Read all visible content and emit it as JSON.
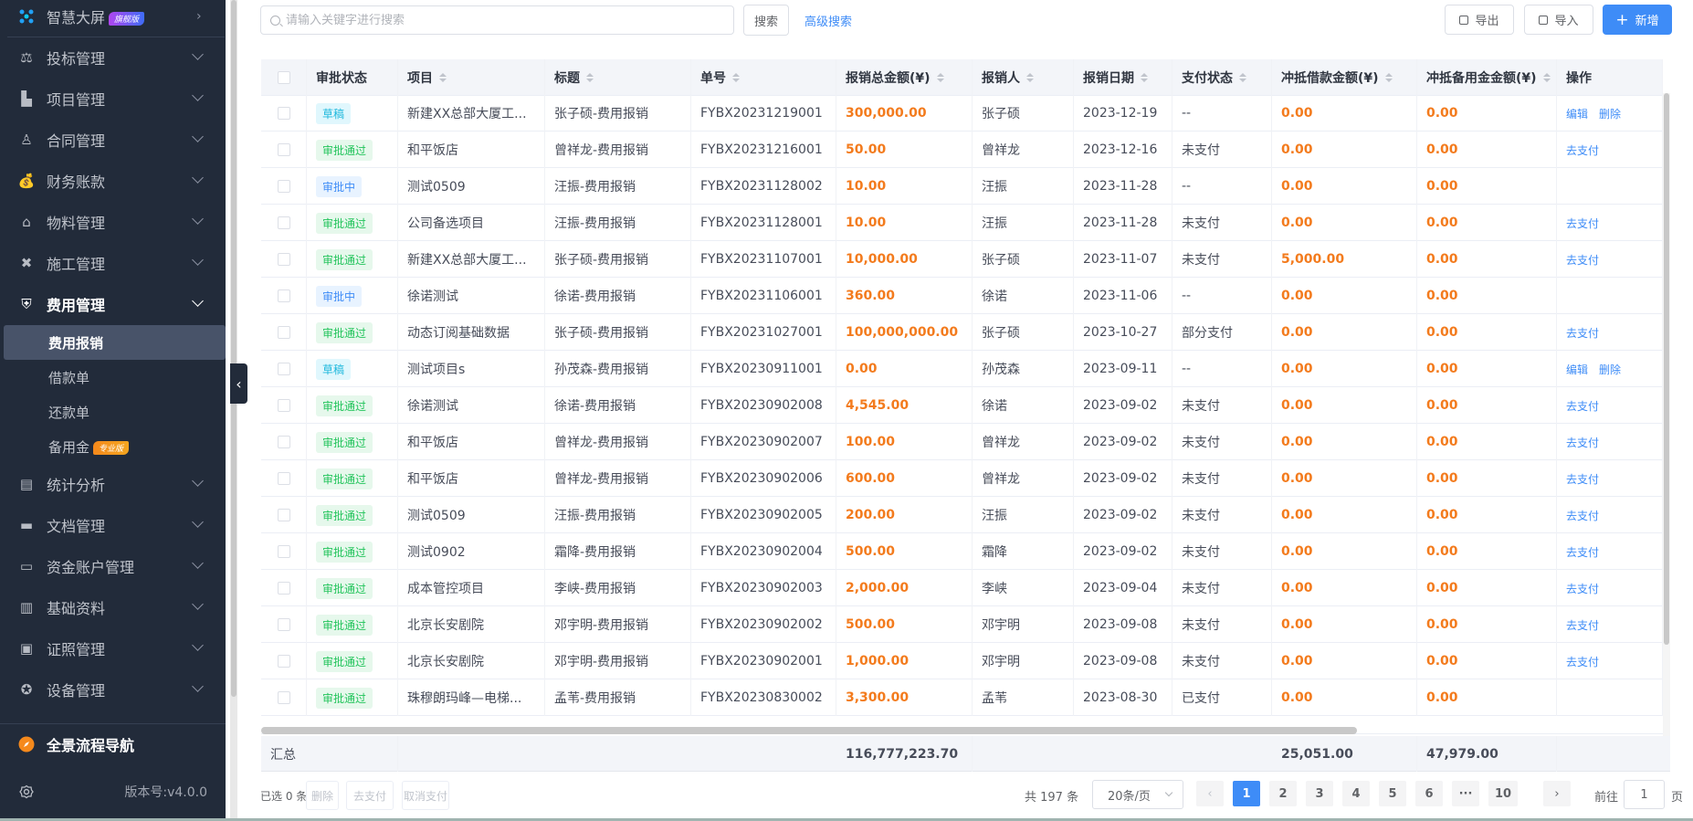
{
  "sidebar": {
    "top_item": {
      "label": "智慧大屏",
      "badge": "旗舰版",
      "icon": "dashboard-icon"
    },
    "items": [
      {
        "label": "投标管理",
        "icon": "gavel-icon"
      },
      {
        "label": "项目管理",
        "icon": "building-icon"
      },
      {
        "label": "合同管理",
        "icon": "stamp-icon"
      },
      {
        "label": "财务账款",
        "icon": "money-bag-icon"
      },
      {
        "label": "物料管理",
        "icon": "warehouse-icon"
      },
      {
        "label": "施工管理",
        "icon": "tools-icon"
      },
      {
        "label": "费用管理",
        "icon": "shield-yen-icon",
        "open": true
      }
    ],
    "sub_items": [
      {
        "label": "费用报销",
        "active": true
      },
      {
        "label": "借款单"
      },
      {
        "label": "还款单"
      },
      {
        "label": "备用金",
        "badge": "专业版"
      }
    ],
    "items_after": [
      {
        "label": "统计分析",
        "icon": "chart-box-icon"
      },
      {
        "label": "文档管理",
        "icon": "folder-icon"
      },
      {
        "label": "资金账户管理",
        "icon": "card-icon"
      },
      {
        "label": "基础资料",
        "icon": "book-icon"
      },
      {
        "label": "证照管理",
        "icon": "id-card-icon"
      },
      {
        "label": "设备管理",
        "icon": "award-icon"
      }
    ],
    "flow_nav": "全景流程导航",
    "version": "版本号:v4.0.0"
  },
  "toolbar": {
    "search_placeholder": "请输入关键字进行搜索",
    "search_value": "",
    "search_button": "搜索",
    "advanced_search": "高级搜索",
    "export": "导出",
    "import": "导入",
    "add": "新增"
  },
  "table": {
    "columns": [
      "审批状态",
      "项目",
      "标题",
      "单号",
      "报销总金额(¥)",
      "报销人",
      "报销日期",
      "支付状态",
      "冲抵借款金额(¥)",
      "冲抵备用金金额(¥)",
      "操作"
    ],
    "rows": [
      {
        "status": "草稿",
        "status_type": "draft",
        "project": "新建XX总部大厦工...",
        "title": "张子硕-费用报销",
        "no": "FYBX20231219001",
        "amount": "300,000.00",
        "person": "张子硕",
        "date": "2023-12-19",
        "pay": "--",
        "loan": "0.00",
        "reserve": "0.00",
        "ops": [
          "编辑",
          "删除"
        ]
      },
      {
        "status": "审批通过",
        "status_type": "passed",
        "project": "和平饭店",
        "title": "曾祥龙-费用报销",
        "no": "FYBX20231216001",
        "amount": "50.00",
        "person": "曾祥龙",
        "date": "2023-12-16",
        "pay": "未支付",
        "loan": "0.00",
        "reserve": "0.00",
        "ops": [
          "去支付"
        ]
      },
      {
        "status": "审批中",
        "status_type": "pending",
        "project": "测试0509",
        "title": "汪振-费用报销",
        "no": "FYBX20231128002",
        "amount": "10.00",
        "person": "汪振",
        "date": "2023-11-28",
        "pay": "--",
        "loan": "0.00",
        "reserve": "0.00",
        "ops": []
      },
      {
        "status": "审批通过",
        "status_type": "passed",
        "project": "公司备选项目",
        "title": "汪振-费用报销",
        "no": "FYBX20231128001",
        "amount": "10.00",
        "person": "汪振",
        "date": "2023-11-28",
        "pay": "未支付",
        "loan": "0.00",
        "reserve": "0.00",
        "ops": [
          "去支付"
        ]
      },
      {
        "status": "审批通过",
        "status_type": "passed",
        "project": "新建XX总部大厦工...",
        "title": "张子硕-费用报销",
        "no": "FYBX20231107001",
        "amount": "10,000.00",
        "person": "张子硕",
        "date": "2023-11-07",
        "pay": "未支付",
        "loan": "5,000.00",
        "reserve": "0.00",
        "ops": [
          "去支付"
        ]
      },
      {
        "status": "审批中",
        "status_type": "pending",
        "project": "徐诺测试",
        "title": "徐诺-费用报销",
        "no": "FYBX20231106001",
        "amount": "360.00",
        "person": "徐诺",
        "date": "2023-11-06",
        "pay": "--",
        "loan": "0.00",
        "reserve": "0.00",
        "ops": []
      },
      {
        "status": "审批通过",
        "status_type": "passed",
        "project": "动态订阅基础数据",
        "title": "张子硕-费用报销",
        "no": "FYBX20231027001",
        "amount": "100,000,000.00",
        "person": "张子硕",
        "date": "2023-10-27",
        "pay": "部分支付",
        "loan": "0.00",
        "reserve": "0.00",
        "ops": [
          "去支付"
        ]
      },
      {
        "status": "草稿",
        "status_type": "draft",
        "project": "测试项目s",
        "title": "孙茂森-费用报销",
        "no": "FYBX20230911001",
        "amount": "0.00",
        "person": "孙茂森",
        "date": "2023-09-11",
        "pay": "--",
        "loan": "0.00",
        "reserve": "0.00",
        "ops": [
          "编辑",
          "删除"
        ]
      },
      {
        "status": "审批通过",
        "status_type": "passed",
        "project": "徐诺测试",
        "title": "徐诺-费用报销",
        "no": "FYBX20230902008",
        "amount": "4,545.00",
        "person": "徐诺",
        "date": "2023-09-02",
        "pay": "未支付",
        "loan": "0.00",
        "reserve": "0.00",
        "ops": [
          "去支付"
        ]
      },
      {
        "status": "审批通过",
        "status_type": "passed",
        "project": "和平饭店",
        "title": "曾祥龙-费用报销",
        "no": "FYBX20230902007",
        "amount": "100.00",
        "person": "曾祥龙",
        "date": "2023-09-02",
        "pay": "未支付",
        "loan": "0.00",
        "reserve": "0.00",
        "ops": [
          "去支付"
        ]
      },
      {
        "status": "审批通过",
        "status_type": "passed",
        "project": "和平饭店",
        "title": "曾祥龙-费用报销",
        "no": "FYBX20230902006",
        "amount": "600.00",
        "person": "曾祥龙",
        "date": "2023-09-02",
        "pay": "未支付",
        "loan": "0.00",
        "reserve": "0.00",
        "ops": [
          "去支付"
        ]
      },
      {
        "status": "审批通过",
        "status_type": "passed",
        "project": "测试0509",
        "title": "汪振-费用报销",
        "no": "FYBX20230902005",
        "amount": "200.00",
        "person": "汪振",
        "date": "2023-09-02",
        "pay": "未支付",
        "loan": "0.00",
        "reserve": "0.00",
        "ops": [
          "去支付"
        ]
      },
      {
        "status": "审批通过",
        "status_type": "passed",
        "project": "测试0902",
        "title": "霜降-费用报销",
        "no": "FYBX20230902004",
        "amount": "500.00",
        "person": "霜降",
        "date": "2023-09-02",
        "pay": "未支付",
        "loan": "0.00",
        "reserve": "0.00",
        "ops": [
          "去支付"
        ]
      },
      {
        "status": "审批通过",
        "status_type": "passed",
        "project": "成本管控项目",
        "title": "李峡-费用报销",
        "no": "FYBX20230902003",
        "amount": "2,000.00",
        "person": "李峡",
        "date": "2023-09-04",
        "pay": "未支付",
        "loan": "0.00",
        "reserve": "0.00",
        "ops": [
          "去支付"
        ]
      },
      {
        "status": "审批通过",
        "status_type": "passed",
        "project": "北京长安剧院",
        "title": "邓宇明-费用报销",
        "no": "FYBX20230902002",
        "amount": "500.00",
        "person": "邓宇明",
        "date": "2023-09-08",
        "pay": "未支付",
        "loan": "0.00",
        "reserve": "0.00",
        "ops": [
          "去支付"
        ]
      },
      {
        "status": "审批通过",
        "status_type": "passed",
        "project": "北京长安剧院",
        "title": "邓宇明-费用报销",
        "no": "FYBX20230902001",
        "amount": "1,000.00",
        "person": "邓宇明",
        "date": "2023-09-08",
        "pay": "未支付",
        "loan": "0.00",
        "reserve": "0.00",
        "ops": [
          "去支付"
        ]
      },
      {
        "status": "审批通过",
        "status_type": "passed",
        "project": "珠穆朗玛峰—电梯...",
        "title": "孟苇-费用报销",
        "no": "FYBX20230830002",
        "amount": "3,300.00",
        "person": "孟苇",
        "date": "2023-08-30",
        "pay": "已支付",
        "loan": "0.00",
        "reserve": "0.00",
        "ops": []
      }
    ],
    "summary": {
      "label": "汇总",
      "amount": "116,777,223.70",
      "loan": "25,051.00",
      "reserve": "47,979.00"
    }
  },
  "footer": {
    "selected": "已选 0 条",
    "delete": "删除",
    "pay": "去支付",
    "cancel_pay": "取消支付",
    "total": "共 197 条",
    "page_size": "20条/页",
    "pages": [
      "1",
      "2",
      "3",
      "4",
      "5",
      "6",
      "···",
      "10"
    ],
    "current_page": "1",
    "goto_label": "前往",
    "goto_value": "1",
    "page_suffix": "页"
  },
  "colors": {
    "accent": "#3e8cf7",
    "amount": "#f37b1d",
    "sidebar_bg": "#222b3a"
  }
}
